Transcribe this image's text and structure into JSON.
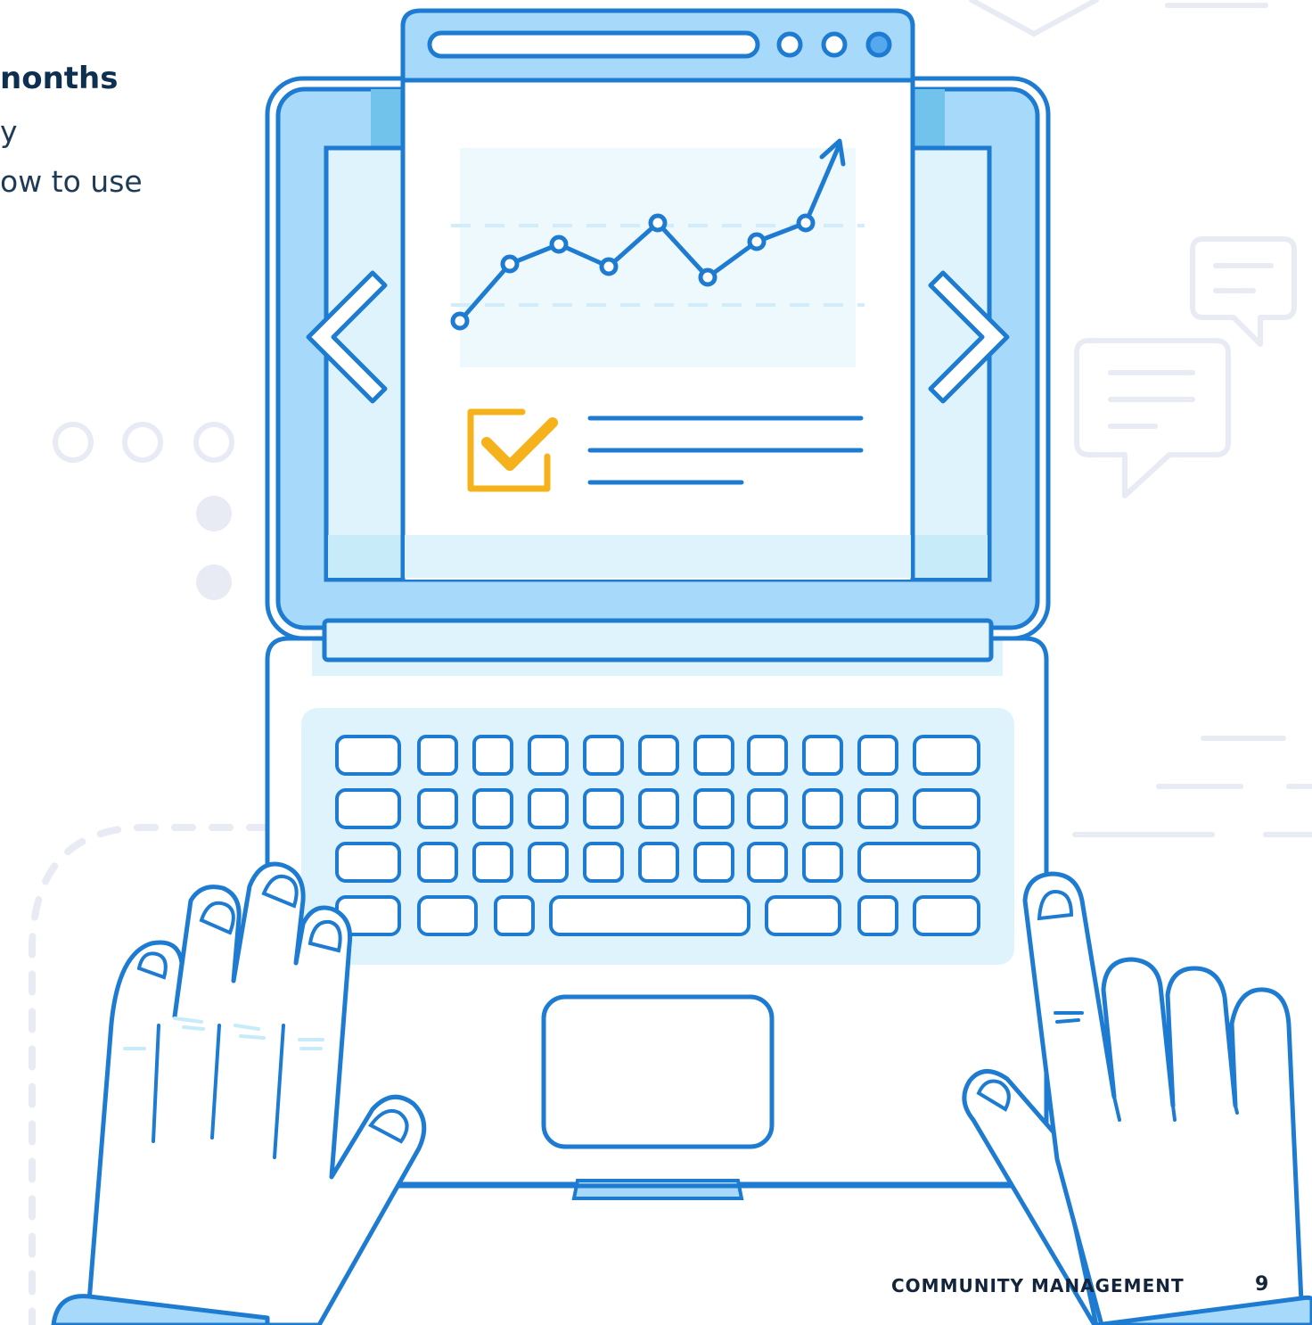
{
  "page": {
    "heading_fragment": "nonths",
    "body_fragment_line1": "y",
    "body_fragment_line2": "ow to use",
    "footer_label": "COMMUNITY MANAGEMENT",
    "page_number": "9"
  },
  "colors": {
    "stroke": "#1e7bd2",
    "screen_fill": "#a7dafa",
    "panel_fill": "#dff3fc",
    "chart_area": "#eef9fd",
    "accent_yellow": "#f5b21a",
    "decor_gray": "#e8ebf3",
    "text_dark": "#0d3050"
  },
  "icons": [
    "laptop-illustration",
    "line-chart-icon",
    "checkbox-icon",
    "left-arrow-icon",
    "right-arrow-icon",
    "speech-bubble-icon",
    "hand-illustration"
  ]
}
